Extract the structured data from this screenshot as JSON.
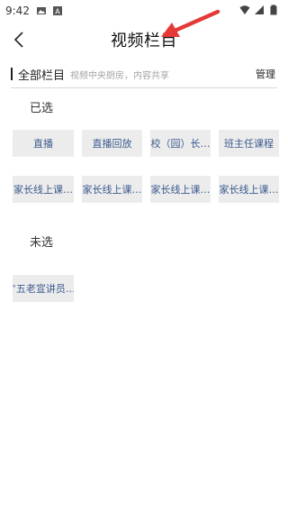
{
  "status": {
    "time": "9:42",
    "left_icons": [
      "image-icon",
      "font-icon"
    ],
    "right_icons": [
      "wifi-icon",
      "signal-icon",
      "battery-icon"
    ]
  },
  "header": {
    "title": "视频栏目",
    "back_icon": "chevron-left-icon"
  },
  "section": {
    "title": "全部栏目",
    "subtitle": "视频中央厨房，内容共享",
    "manage_label": "管理"
  },
  "selected": {
    "label": "已选",
    "items": [
      {
        "label": "直播"
      },
      {
        "label": "直播回放"
      },
      {
        "label": "校（园）长…"
      },
      {
        "label": "班主任课程"
      },
      {
        "label": "家长线上课…"
      },
      {
        "label": "家长线上课…"
      },
      {
        "label": "家长线上课…"
      },
      {
        "label": "家长线上课…"
      }
    ]
  },
  "unselected": {
    "label": "未选",
    "items": [
      {
        "label": "“五老宣讲员…"
      }
    ]
  },
  "colors": {
    "chip_bg": "#ececec",
    "chip_text": "#3c5b8e",
    "arrow": "#e53935"
  }
}
